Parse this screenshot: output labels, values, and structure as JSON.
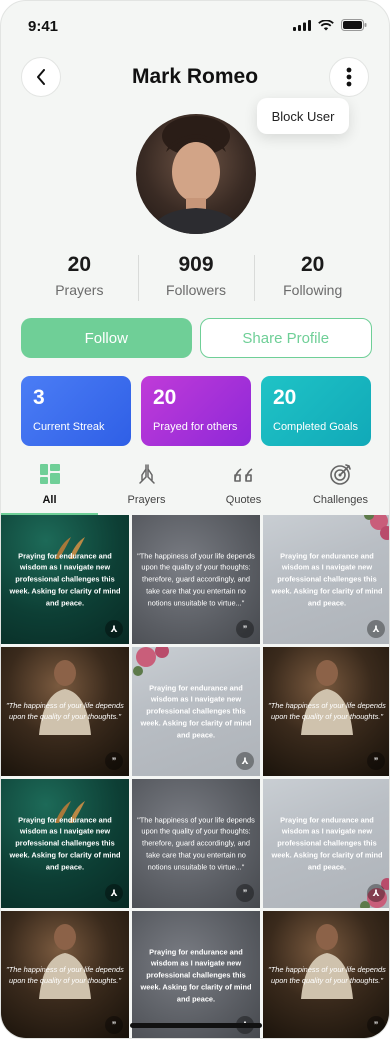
{
  "status_bar": {
    "time": "9:41"
  },
  "header": {
    "title": "Mark Romeo"
  },
  "dropdown": {
    "block_user": "Block User"
  },
  "stats": [
    {
      "value": "20",
      "label": "Prayers"
    },
    {
      "value": "909",
      "label": "Followers"
    },
    {
      "value": "20",
      "label": "Following"
    }
  ],
  "actions": {
    "follow": "Follow",
    "share": "Share Profile"
  },
  "cards": [
    {
      "value": "3",
      "label": "Current Streak",
      "color": "#3b6ff0"
    },
    {
      "value": "20",
      "label": "Prayed for others",
      "color": "#a630d8"
    },
    {
      "value": "20",
      "label": "Completed Goals",
      "color": "#15b6bf"
    }
  ],
  "tabs": [
    {
      "label": "All",
      "icon": "grid-icon"
    },
    {
      "label": "Prayers",
      "icon": "praying-hands-icon"
    },
    {
      "label": "Quotes",
      "icon": "quote-icon"
    },
    {
      "label": "Challenges",
      "icon": "target-icon"
    }
  ],
  "tiles": {
    "prayer": "Praying for endurance and wisdom as I navigate new professional challenges this week. Asking for clarity of mind and peace.",
    "quote_long": "\"The happiness of your life depends upon the quality of your thoughts: therefore, guard accordingly, and take care that you entertain no notions unsuitable to virtue...\"",
    "quote_short": "\"The happiness of your life depends upon the quality of your thoughts.\""
  },
  "accent_color": "#6fcf97"
}
